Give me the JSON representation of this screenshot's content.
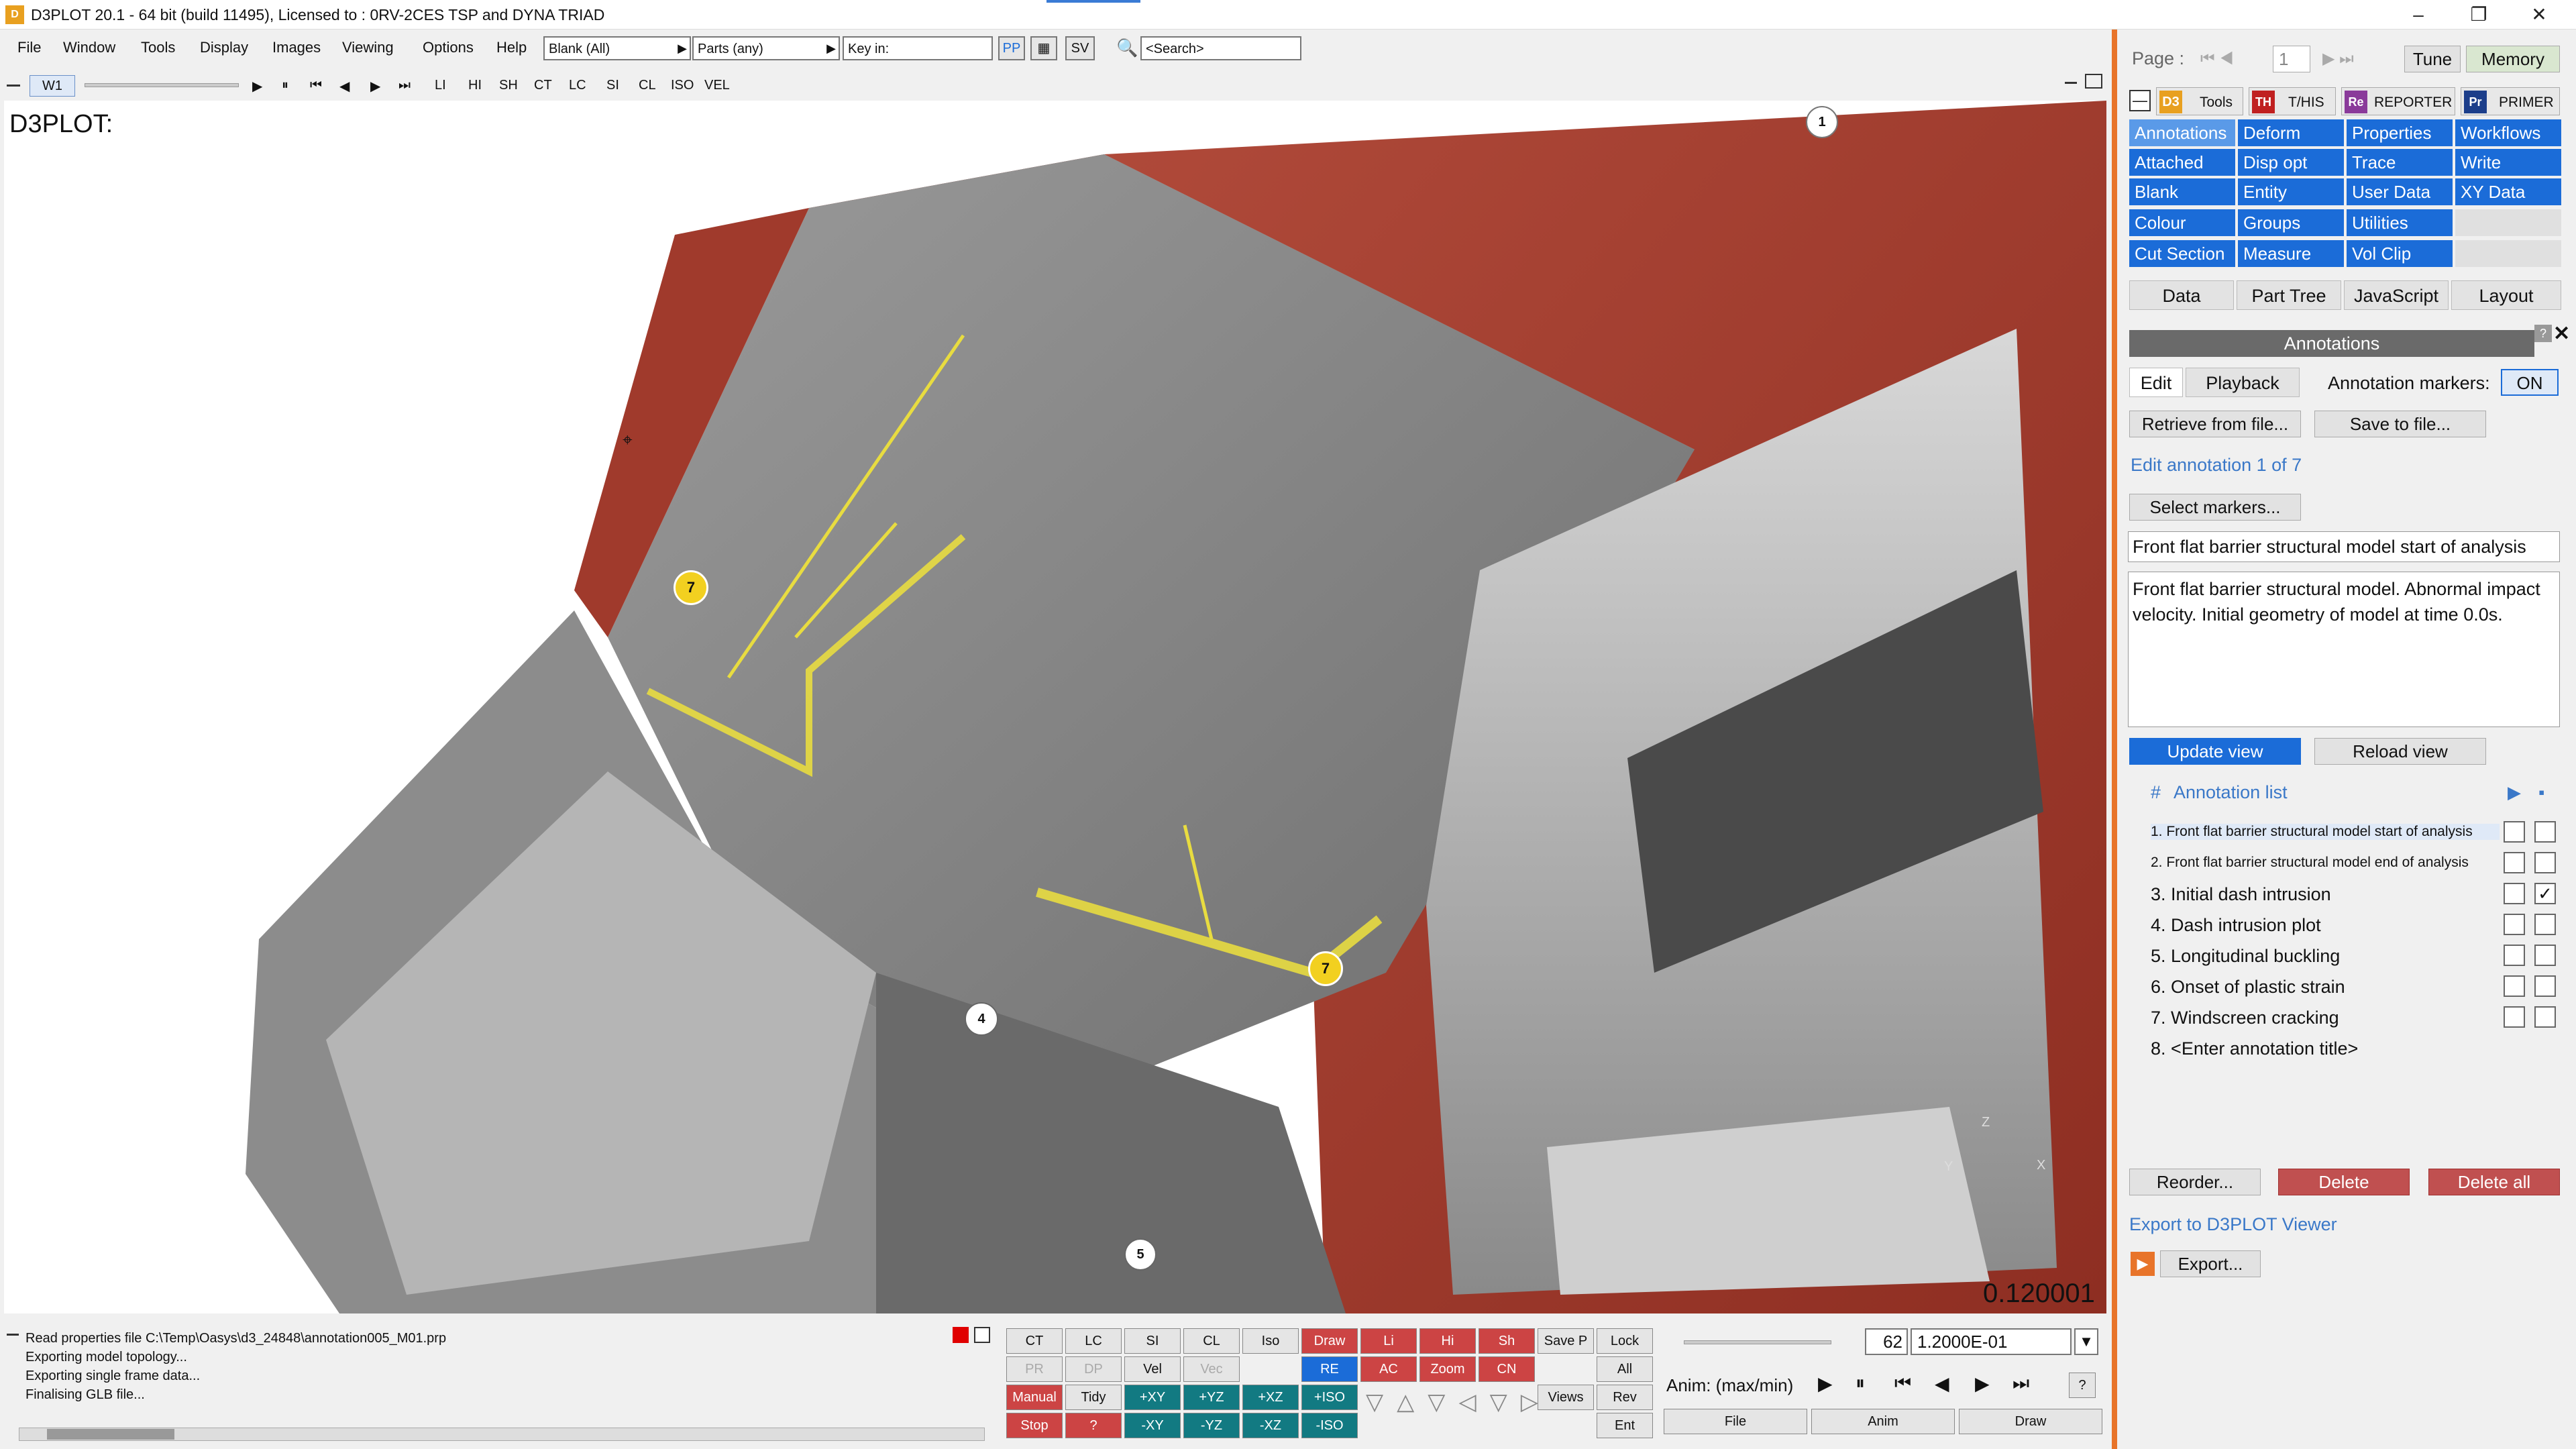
{
  "window": {
    "title": "D3PLOT 20.1 - 64 bit (build 11495), Licensed to : 0RV-2CES TSP and DYNA TRIAD",
    "minimize": "–",
    "restore": "❐",
    "close": "✕"
  },
  "menu": [
    "File",
    "Window",
    "Tools",
    "Display",
    "Images",
    "Viewing",
    "Options",
    "Help"
  ],
  "toolbar": {
    "blank_combo": "Blank (All)",
    "parts_combo": "Parts (any)",
    "key_in": "Key in:",
    "pp": "PP",
    "sv": "SV",
    "search_placeholder": "<Search>"
  },
  "toolbar2": {
    "window_tab": "W1",
    "modes": [
      "LI",
      "HI",
      "SH",
      "CT",
      "LC",
      "SI",
      "CL",
      "ISO",
      "VEL"
    ]
  },
  "viewport": {
    "label": "D3PLOT:",
    "time": "0.120001",
    "markers": [
      "1",
      "7",
      "7",
      "4",
      "5"
    ],
    "triad": [
      "Z",
      "X",
      "Y"
    ]
  },
  "messages": [
    "Read properties file C:\\Temp\\Oasys\\d3_24848\\annotation005_M01.prp",
    "Exporting model topology...",
    "Exporting single frame data...",
    "Finalising GLB file..."
  ],
  "bottom_buttons": {
    "row1": [
      "CT",
      "LC",
      "SI",
      "CL",
      "Iso",
      "Draw",
      "Li",
      "Hi",
      "Sh",
      "Save P",
      "Lock"
    ],
    "row2": [
      "PR",
      "DP",
      "Vel",
      "Vec",
      "RE",
      "AC",
      "Zoom",
      "CN",
      "All"
    ],
    "row3": [
      "Manual",
      "Tidy",
      "+XY",
      "+YZ",
      "+XZ",
      "+ISO",
      "Views",
      "Rev"
    ],
    "row4": [
      "Stop",
      "?",
      "-XY",
      "-YZ",
      "-XZ",
      "-ISO",
      "Ent"
    ]
  },
  "anim": {
    "frame": "62",
    "time_value": "1.2000E-01",
    "speed_label": "Anim: (max/min)",
    "help": "?",
    "file": "File",
    "anim": "Anim",
    "draw": "Draw"
  },
  "panel": {
    "page_label": "Page :",
    "page_num": "1",
    "tune": "Tune",
    "memory": "Memory",
    "app_tabs": [
      "Tools",
      "T/HIS",
      "REPORTER",
      "PRIMER"
    ],
    "tool_buttons": [
      [
        "Annotations",
        "Deform",
        "Properties",
        "Workflows"
      ],
      [
        "Attached",
        "Disp opt",
        "Trace",
        "Write"
      ],
      [
        "Blank",
        "Entity",
        "User Data",
        "XY Data"
      ],
      [
        "Colour",
        "Groups",
        "Utilities",
        ""
      ],
      [
        "Cut Section",
        "Measure",
        "Vol Clip",
        ""
      ]
    ],
    "sub_tabs": [
      "Data",
      "Part Tree",
      "JavaScript",
      "Layout"
    ],
    "section_title": "Annotations",
    "edit_tab": "Edit",
    "playback_tab": "Playback",
    "markers_label": "Annotation markers:",
    "markers_state": "ON",
    "retrieve": "Retrieve from file...",
    "save": "Save to file...",
    "edit_label": "Edit annotation 1 of 7",
    "select_markers": "Select markers...",
    "title_value": "Front flat barrier structural model start of analysis",
    "description": "Front flat barrier structural model. Abnormal impact velocity. Initial geometry of model at time 0.0s.",
    "update_view": "Update view",
    "reload_view": "Reload view",
    "list_hash": "#",
    "list_title": "Annotation list",
    "annotations": [
      {
        "num": "1.",
        "title": "Front flat barrier structural model start of analysis"
      },
      {
        "num": "2.",
        "title": "Front flat barrier structural model end of analysis"
      },
      {
        "num": "3.",
        "title": "Initial dash intrusion"
      },
      {
        "num": "4.",
        "title": "Dash intrusion plot"
      },
      {
        "num": "5.",
        "title": "Longitudinal buckling"
      },
      {
        "num": "6.",
        "title": "Onset of plastic strain"
      },
      {
        "num": "7.",
        "title": "Windscreen cracking"
      },
      {
        "num": "8.",
        "title": "<Enter annotation title>"
      }
    ],
    "checked_row": 3,
    "reorder": "Reorder...",
    "delete": "Delete",
    "delete_all": "Delete all",
    "export_viewer": "Export to D3PLOT Viewer",
    "export": "Export..."
  },
  "colors": {
    "car_body": "#a83a2c",
    "highlight": "#e8dc40",
    "accent_orange": "#e8742a",
    "blue_button": "#1b6cd8"
  }
}
